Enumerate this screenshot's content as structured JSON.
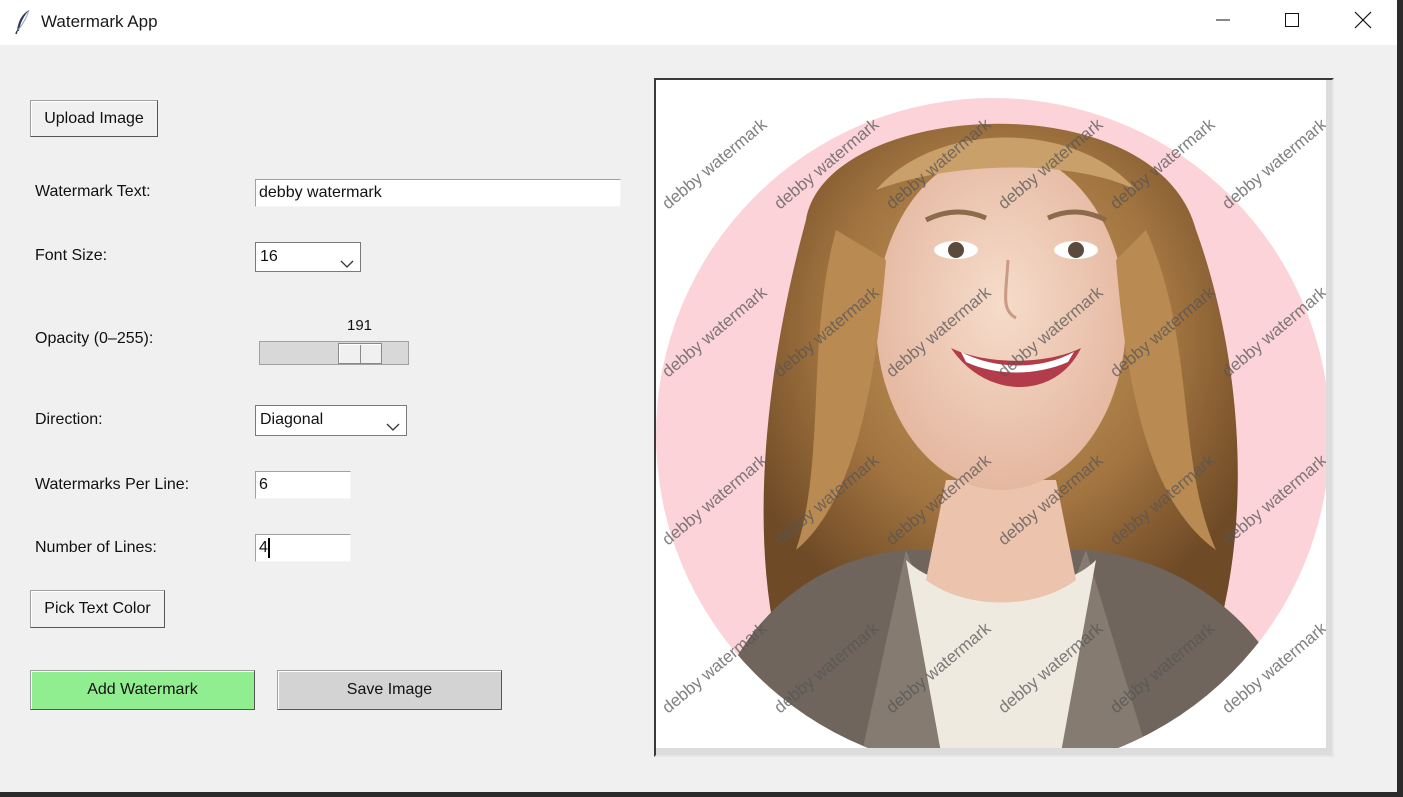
{
  "window": {
    "title": "Watermark App",
    "controls": [
      "minimize-icon",
      "maximize-icon",
      "close-icon"
    ]
  },
  "buttons": {
    "upload": "Upload Image",
    "pick_color": "Pick Text Color",
    "add_watermark": "Add Watermark",
    "save_image": "Save Image"
  },
  "form": {
    "watermark_text_label": "Watermark Text:",
    "watermark_text_value": "debby watermark",
    "font_size_label": "Font Size:",
    "font_size_value": "16",
    "opacity_label": "Opacity (0–255):",
    "opacity_value": "191",
    "opacity_min": 0,
    "opacity_max": 255,
    "direction_label": "Direction:",
    "direction_value": "Diagonal",
    "per_line_label": "Watermarks Per Line:",
    "per_line_value": "6",
    "lines_label": "Number of Lines:",
    "lines_value": "4"
  },
  "preview": {
    "watermark_text": "debby watermark",
    "circle_color": "#fcd3d8",
    "watermark_color": "#555555"
  },
  "colors": {
    "add_button_bg": "#90ee90",
    "save_button_bg": "#d3d3d3",
    "window_bg": "#f0f0f0"
  },
  "icons": {
    "app": "feather-icon",
    "dropdown": "chevron-down-icon"
  }
}
